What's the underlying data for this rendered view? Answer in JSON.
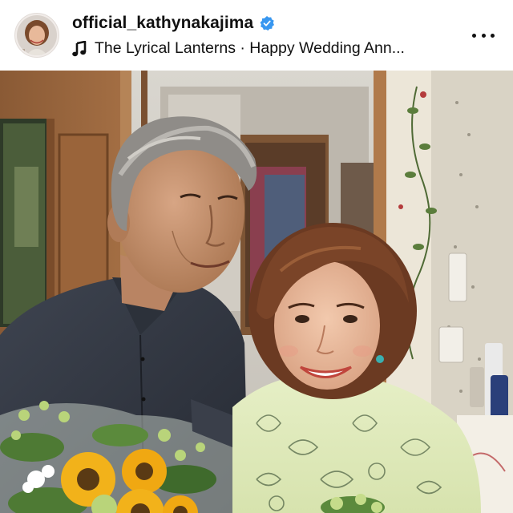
{
  "post": {
    "username": "official_kathynakajima",
    "verified": true,
    "audio_track": "The Lyrical Lanterns · Happy Wedding Ann...",
    "icons": {
      "verified": "verified-badge-icon",
      "music": "music-note-icon",
      "more": "more-options-icon"
    },
    "colors": {
      "verified_badge": "#3897f0",
      "text": "#111111",
      "background": "#ffffff"
    }
  },
  "photo": {
    "subject": "photo"
  }
}
